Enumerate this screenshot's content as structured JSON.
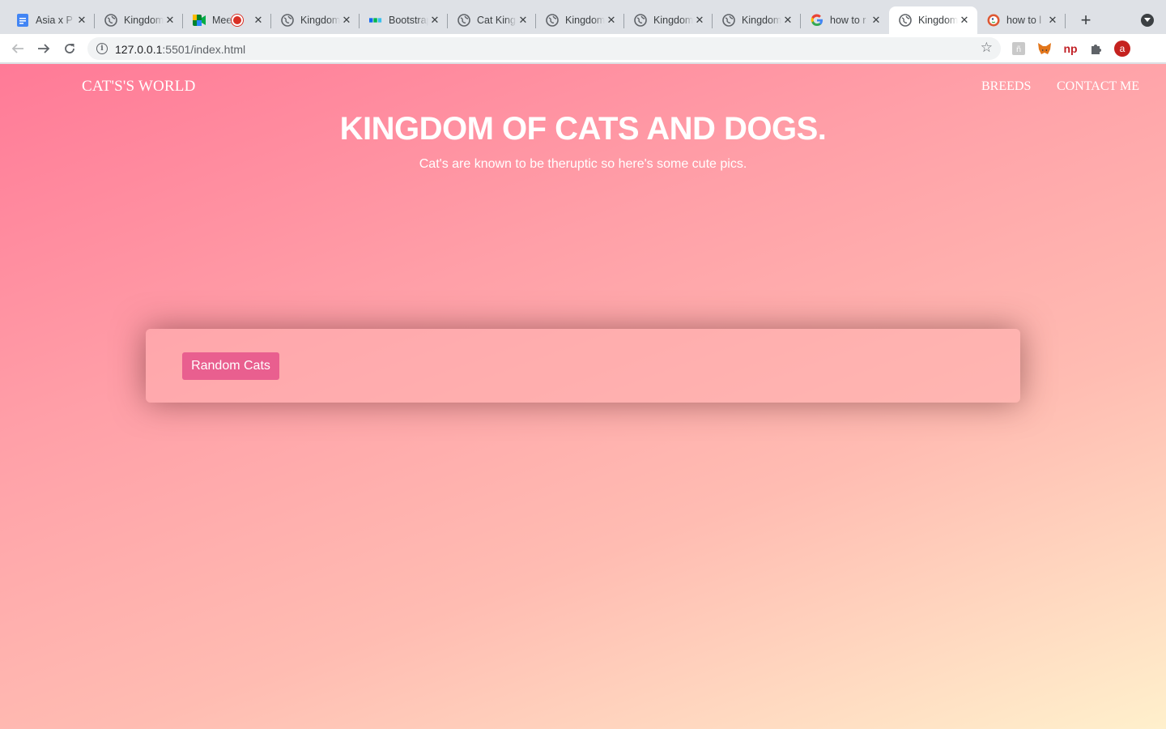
{
  "browser": {
    "tabs": [
      {
        "title": "Asia x P",
        "icon": "google-docs-icon"
      },
      {
        "title": "Kingdom",
        "icon": "globe-icon"
      },
      {
        "title": "Mee",
        "icon": "google-meet-icon",
        "recording": true
      },
      {
        "title": "Kingdom",
        "icon": "globe-icon"
      },
      {
        "title": "Bootstrap",
        "icon": "mdb-icon"
      },
      {
        "title": "Cat King",
        "icon": "globe-icon"
      },
      {
        "title": "Kingdom",
        "icon": "globe-icon"
      },
      {
        "title": "Kingdom",
        "icon": "globe-icon"
      },
      {
        "title": "Kingdom",
        "icon": "globe-icon"
      },
      {
        "title": "how to r",
        "icon": "google-icon"
      },
      {
        "title": "Kingdom",
        "icon": "globe-icon",
        "active": true
      },
      {
        "title": "how to l",
        "icon": "duckduckgo-icon"
      }
    ],
    "url_host": "127.0.0.1",
    "url_rest": ":5501/index.html",
    "profile_initial": "a",
    "extension_np_label": "np"
  },
  "site": {
    "brand": "CAT'S'S WORLD",
    "nav": {
      "breeds": "BREEDS",
      "contact": "CONTACT ME"
    },
    "hero": {
      "title": "KINGDOM OF CATS AND DOGS.",
      "subtitle": "Cat's are known to be theruptic so here's some cute pics."
    },
    "random_button": "Random Cats"
  },
  "colors": {
    "gradient_start": "#ff7a97",
    "gradient_end": "#fff0cc",
    "button": "#e95f8f"
  }
}
